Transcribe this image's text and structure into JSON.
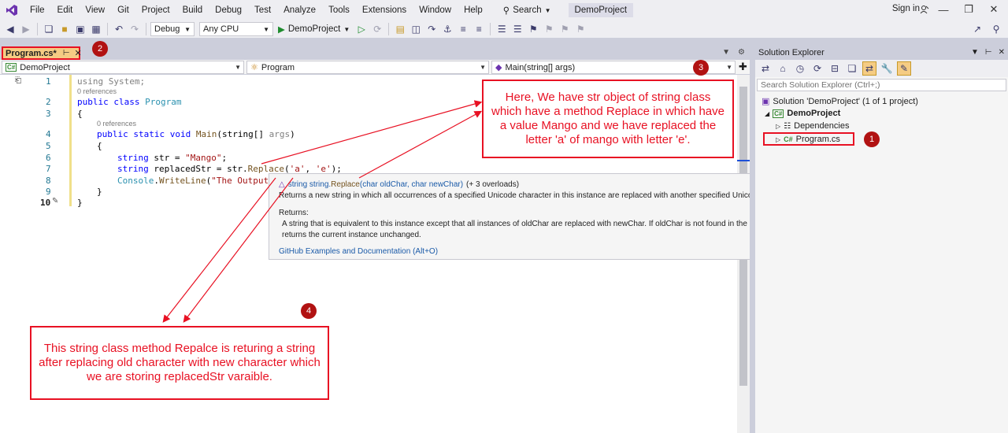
{
  "menu": {
    "items": [
      "File",
      "Edit",
      "View",
      "Git",
      "Project",
      "Build",
      "Debug",
      "Test",
      "Analyze",
      "Tools",
      "Extensions",
      "Window",
      "Help"
    ],
    "search_label": "Search",
    "project_title": "DemoProject",
    "sign_in": "Sign in"
  },
  "toolbar": {
    "config": "Debug",
    "platform": "Any CPU",
    "run_target": "DemoProject"
  },
  "tab": {
    "label": "Program.cs*"
  },
  "navbar": {
    "project": "DemoProject",
    "class": "Program",
    "member": "Main(string[] args)"
  },
  "editor": {
    "line_numbers": [
      "1",
      "2",
      "3",
      "4",
      "5",
      "6",
      "7",
      "8",
      "9",
      "10"
    ],
    "references_1": "0 references",
    "references_2": "0 references",
    "code": {
      "l1_kw": "using",
      "l1_rest": " System;",
      "l2_kw": "public class ",
      "l2_ty": "Program",
      "l3": "{",
      "l4_kw": "public static void ",
      "l4_fn": "Main",
      "l4_args": "(string[] ",
      "l4_gray": "args",
      "l4_end": ")",
      "l5": "{",
      "l6_kw": "string",
      "l6_mid": " str = ",
      "l6_str": "\"Mango\"",
      "l6_end": ";",
      "l7_kw": "string",
      "l7_mid": " replacedStr = str.",
      "l7_fn": "Replace",
      "l7_open": "(",
      "l7_a": "'a'",
      "l7_comma": ", ",
      "l7_e": "'e'",
      "l7_end": ");",
      "l8_ty": "Console",
      "l8_mid": ".",
      "l8_fn": "WriteLine",
      "l8_open": "(",
      "l8_str": "\"The Output",
      "l9": "}",
      "l10": "}"
    }
  },
  "quickinfo": {
    "signature_prefix": "string string.",
    "signature_method": "Replace",
    "signature_params": "(char oldChar, char newChar)",
    "signature_overloads": "(+ 3 overloads)",
    "description": "Returns a new string in which all occurrences of a specified Unicode character in this instance are replaced with another specified Unicode character.",
    "returns_heading": "Returns:",
    "returns_text": "A string that is equivalent to this instance except that all instances of oldChar are replaced with newChar. If oldChar is not found in the current instance, the method returns the current instance unchanged.",
    "link": "GitHub Examples and Documentation (Alt+O)"
  },
  "solution_explorer": {
    "title": "Solution Explorer",
    "search_placeholder": "Search Solution Explorer (Ctrl+;)",
    "solution": "Solution 'DemoProject' (1 of 1 project)",
    "project": "DemoProject",
    "dependencies": "Dependencies",
    "file": "Program.cs",
    "cs_badge": "C#"
  },
  "annotations": {
    "badges": [
      "1",
      "2",
      "3",
      "4"
    ],
    "callout_top": "Here, We have str object of string class which have a method Replace in which have a value Mango and we have replaced the letter 'a' of mango with letter 'e'.",
    "callout_bottom": "This string class method Repalce is returing a string after replacing old character with new character which we are storing replacedStr varaible.",
    "color": "#e81123"
  }
}
